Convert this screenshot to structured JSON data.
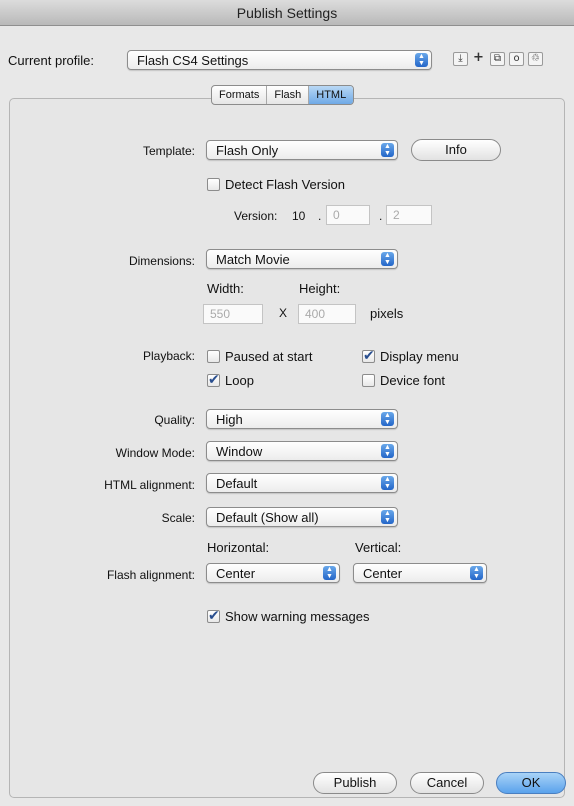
{
  "window": {
    "title": "Publish Settings"
  },
  "profile": {
    "label": "Current profile:",
    "value": "Flash CS4 Settings"
  },
  "profile_tools": [
    {
      "name": "import-export-icon",
      "glyph": "⤓"
    },
    {
      "name": "add-profile-icon",
      "glyph": "+"
    },
    {
      "name": "duplicate-profile-icon",
      "glyph": "⧉"
    },
    {
      "name": "profile-info-icon",
      "glyph": "o"
    },
    {
      "name": "delete-profile-icon",
      "glyph": "♲"
    }
  ],
  "tabs": [
    {
      "label": "Formats",
      "active": false
    },
    {
      "label": "Flash",
      "active": false
    },
    {
      "label": "HTML",
      "active": true
    }
  ],
  "template": {
    "label": "Template:",
    "value": "Flash Only",
    "info_button": "Info"
  },
  "detect_flash": {
    "label": "Detect Flash Version",
    "checked": false
  },
  "version": {
    "label": "Version:",
    "major": "10",
    "minor": "0",
    "revision": "2",
    "sep": "."
  },
  "dimensions": {
    "label": "Dimensions:",
    "value": "Match Movie",
    "width_label": "Width:",
    "height_label": "Height:",
    "width": "550",
    "height": "400",
    "times": "X",
    "units": "pixels"
  },
  "playback": {
    "label": "Playback:",
    "paused_at_start": {
      "label": "Paused at start",
      "checked": false
    },
    "display_menu": {
      "label": "Display menu",
      "checked": true
    },
    "loop": {
      "label": "Loop",
      "checked": true
    },
    "device_font": {
      "label": "Device font",
      "checked": false
    }
  },
  "quality": {
    "label": "Quality:",
    "value": "High"
  },
  "window_mode": {
    "label": "Window Mode:",
    "value": "Window"
  },
  "html_alignment": {
    "label": "HTML alignment:",
    "value": "Default"
  },
  "scale": {
    "label": "Scale:",
    "value": "Default (Show all)"
  },
  "flash_alignment": {
    "label": "Flash alignment:",
    "horizontal_label": "Horizontal:",
    "vertical_label": "Vertical:",
    "horizontal": "Center",
    "vertical": "Center"
  },
  "show_warnings": {
    "label": "Show warning messages",
    "checked": true
  },
  "buttons": {
    "publish": "Publish",
    "cancel": "Cancel",
    "ok": "OK"
  },
  "colors": {
    "accent": "#2466c8",
    "default_button": "#5aa2ec"
  }
}
